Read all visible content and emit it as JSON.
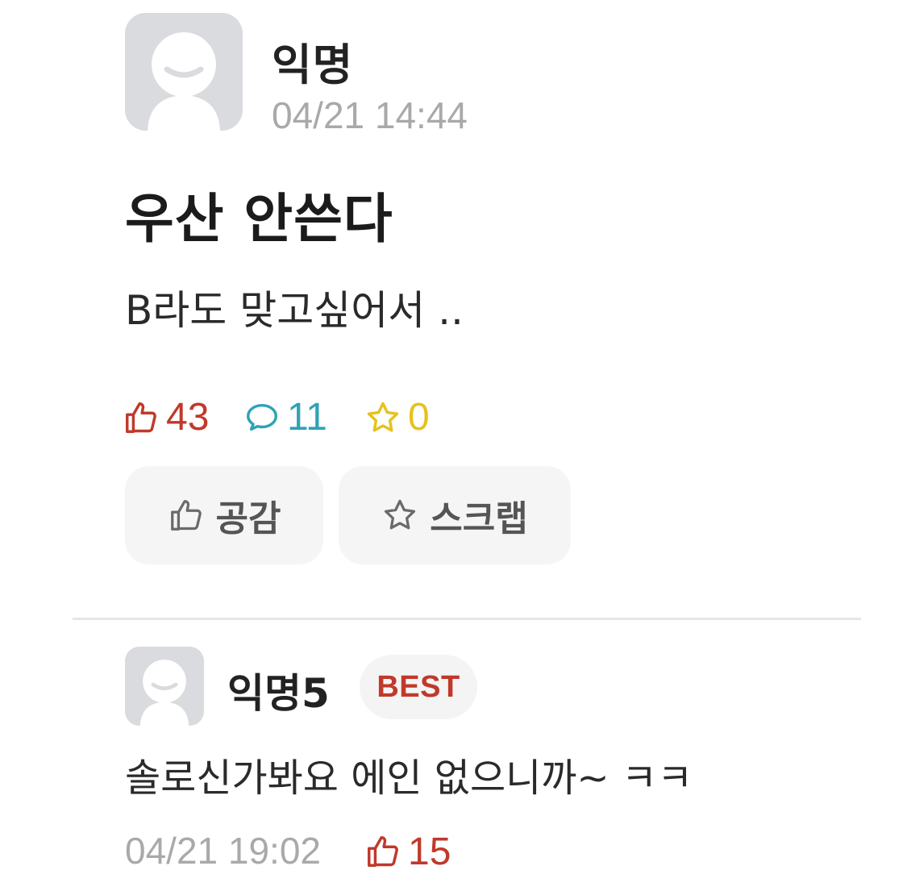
{
  "post": {
    "author": "익명",
    "time": "04/21 14:44",
    "title": "우산 안쓴다",
    "body": "B라도 맞고싶어서 ..",
    "stats": {
      "likes": "43",
      "comments": "11",
      "scraps": "0"
    },
    "actions": {
      "like_label": "공감",
      "scrap_label": "스크랩"
    }
  },
  "comment": {
    "author": "익명5",
    "badge": "BEST",
    "text": "솔로신가봐요 에인 없으니까~ ㅋㅋ",
    "time": "04/21 19:02",
    "likes": "15"
  },
  "icons": {
    "like": "thumbs-up-icon",
    "comment": "speech-bubble-icon",
    "scrap": "star-icon",
    "avatar": "default-avatar-icon"
  },
  "colors": {
    "like": "#c0392b",
    "comment": "#2ea3b5",
    "scrap": "#e6c21d",
    "muted": "#a9a9a9",
    "avatar_bg": "#d9dbdf",
    "button_bg": "#f5f5f5"
  }
}
